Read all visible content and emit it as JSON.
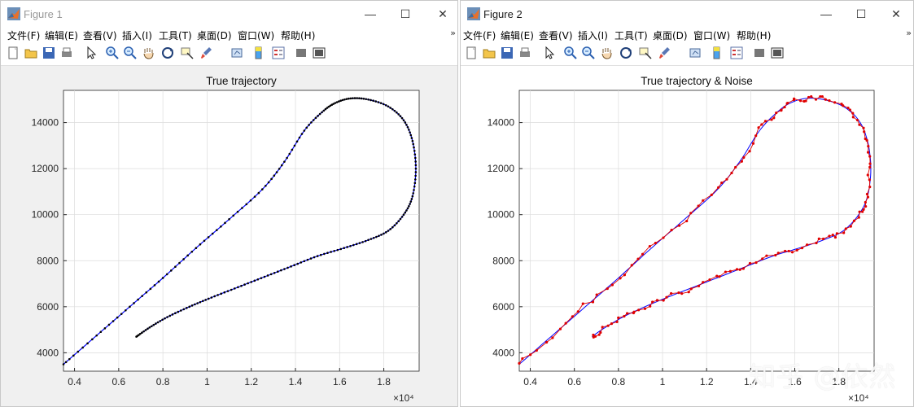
{
  "figure1": {
    "window_title": "Figure 1",
    "menu": [
      "文件(F)",
      "编辑(E)",
      "查看(V)",
      "插入(I)",
      "工具(T)",
      "桌面(D)",
      "窗口(W)",
      "帮助(H)"
    ],
    "menu_more": "»",
    "toolbar_icons": [
      "new-figure-icon",
      "open-file-icon",
      "save-icon",
      "print-icon",
      "pointer-icon",
      "zoom-in-icon",
      "zoom-out-icon",
      "pan-hand-icon",
      "rotate-3d-icon",
      "data-cursor-icon",
      "brush-icon",
      "link-plot-icon",
      "colorbar-icon",
      "legend-icon",
      "hide-plot-tools-icon",
      "show-plot-tools-icon"
    ],
    "chart_data": {
      "type": "scatter",
      "title": "True trajectory",
      "xlabel": "",
      "ylabel": "",
      "xlim": [
        3500,
        19600
      ],
      "ylim": [
        3200,
        15400
      ],
      "x_tick_values": [
        4000,
        6000,
        8000,
        10000,
        12000,
        14000,
        16000,
        18000
      ],
      "x_tick_labels": [
        "0.4",
        "0.6",
        "0.8",
        "1",
        "1.2",
        "1.4",
        "1.6",
        "1.8"
      ],
      "x_exponent_label": "×10⁴",
      "y_tick_values": [
        4000,
        6000,
        8000,
        10000,
        12000,
        14000
      ],
      "y_tick_labels": [
        "4000",
        "6000",
        "8000",
        "10000",
        "12000",
        "14000"
      ],
      "grid": true,
      "colors": {
        "line": "#0000ff",
        "markers": "#000000"
      },
      "series": [
        {
          "style": "line+dots",
          "x": [
            3500,
            5000,
            6500,
            8000,
            9500,
            11000,
            12500,
            13500,
            14400,
            15200,
            15800,
            16500,
            17300,
            18200,
            18900,
            19300,
            19450,
            19300,
            18900,
            18200,
            17300,
            16200,
            15000,
            13800,
            12600,
            11400,
            10200,
            9200,
            8200,
            7400,
            6800
          ],
          "y": [
            3500,
            4750,
            6000,
            7250,
            8550,
            9800,
            11100,
            12300,
            13650,
            14450,
            14850,
            15050,
            15000,
            14700,
            14100,
            13200,
            12000,
            10800,
            10000,
            9300,
            8900,
            8550,
            8200,
            7750,
            7300,
            6850,
            6400,
            6000,
            5550,
            5100,
            4700
          ]
        }
      ]
    }
  },
  "figure2": {
    "window_title": "Figure 2",
    "menu": [
      "文件(F)",
      "编辑(E)",
      "查看(V)",
      "插入(I)",
      "工具(T)",
      "桌面(D)",
      "窗口(W)",
      "帮助(H)"
    ],
    "menu_more": "»",
    "window_controls": [
      "—",
      "☐",
      "✕"
    ],
    "toolbar_icons": [
      "new-figure-icon",
      "open-file-icon",
      "save-icon",
      "print-icon",
      "pointer-icon",
      "zoom-in-icon",
      "zoom-out-icon",
      "pan-hand-icon",
      "rotate-3d-icon",
      "data-cursor-icon",
      "brush-icon",
      "link-plot-icon",
      "colorbar-icon",
      "legend-icon",
      "hide-plot-tools-icon",
      "show-plot-tools-icon"
    ],
    "chart_data": {
      "type": "line",
      "title": "True trajectory & Noise",
      "xlabel": "",
      "ylabel": "",
      "xlim": [
        3500,
        19600
      ],
      "ylim": [
        3200,
        15400
      ],
      "x_tick_values": [
        4000,
        6000,
        8000,
        10000,
        12000,
        14000,
        16000,
        18000
      ],
      "x_tick_labels": [
        "0.4",
        "0.6",
        "0.8",
        "1",
        "1.2",
        "1.4",
        "1.6",
        "1.8"
      ],
      "x_exponent_label": "×10⁴",
      "y_tick_values": [
        4000,
        6000,
        8000,
        10000,
        12000,
        14000
      ],
      "y_tick_labels": [
        "4000",
        "6000",
        "8000",
        "10000",
        "12000",
        "14000"
      ],
      "grid": true,
      "colors": {
        "truth": "#0000ff",
        "noise": "#e00000"
      },
      "series": [
        {
          "style": "truth-line",
          "x": [
            3500,
            5000,
            6500,
            8000,
            9500,
            11000,
            12500,
            13500,
            14400,
            15200,
            15800,
            16500,
            17300,
            18200,
            18900,
            19300,
            19450,
            19300,
            18900,
            18200,
            17300,
            16200,
            15000,
            13800,
            12600,
            11400,
            10200,
            9200,
            8200,
            7400,
            6800
          ],
          "y": [
            3500,
            4750,
            6000,
            7250,
            8550,
            9800,
            11100,
            12300,
            13650,
            14450,
            14850,
            15050,
            15000,
            14700,
            14100,
            13200,
            12000,
            10800,
            10000,
            9300,
            8900,
            8550,
            8200,
            7750,
            7300,
            6850,
            6400,
            6000,
            5550,
            5100,
            4700
          ]
        },
        {
          "style": "noisy-markers",
          "x": [
            3500,
            5050,
            6450,
            8050,
            9450,
            11050,
            12450,
            13550,
            14350,
            15250,
            15750,
            16550,
            17250,
            18250,
            18850,
            19350,
            19400,
            19250,
            18950,
            18150,
            17350,
            16150,
            15050,
            13750,
            12650,
            11350,
            10250,
            9150,
            8250,
            7350,
            6800
          ],
          "y": [
            3550,
            4700,
            6050,
            7200,
            8600,
            9750,
            11150,
            12250,
            13700,
            14400,
            14900,
            15000,
            15050,
            14650,
            14150,
            13150,
            12050,
            10750,
            10050,
            9250,
            8950,
            8500,
            8250,
            7700,
            7350,
            6800,
            6450,
            5950,
            5600,
            5050,
            4650
          ]
        }
      ]
    }
  },
  "watermark": "知乎 @依然"
}
